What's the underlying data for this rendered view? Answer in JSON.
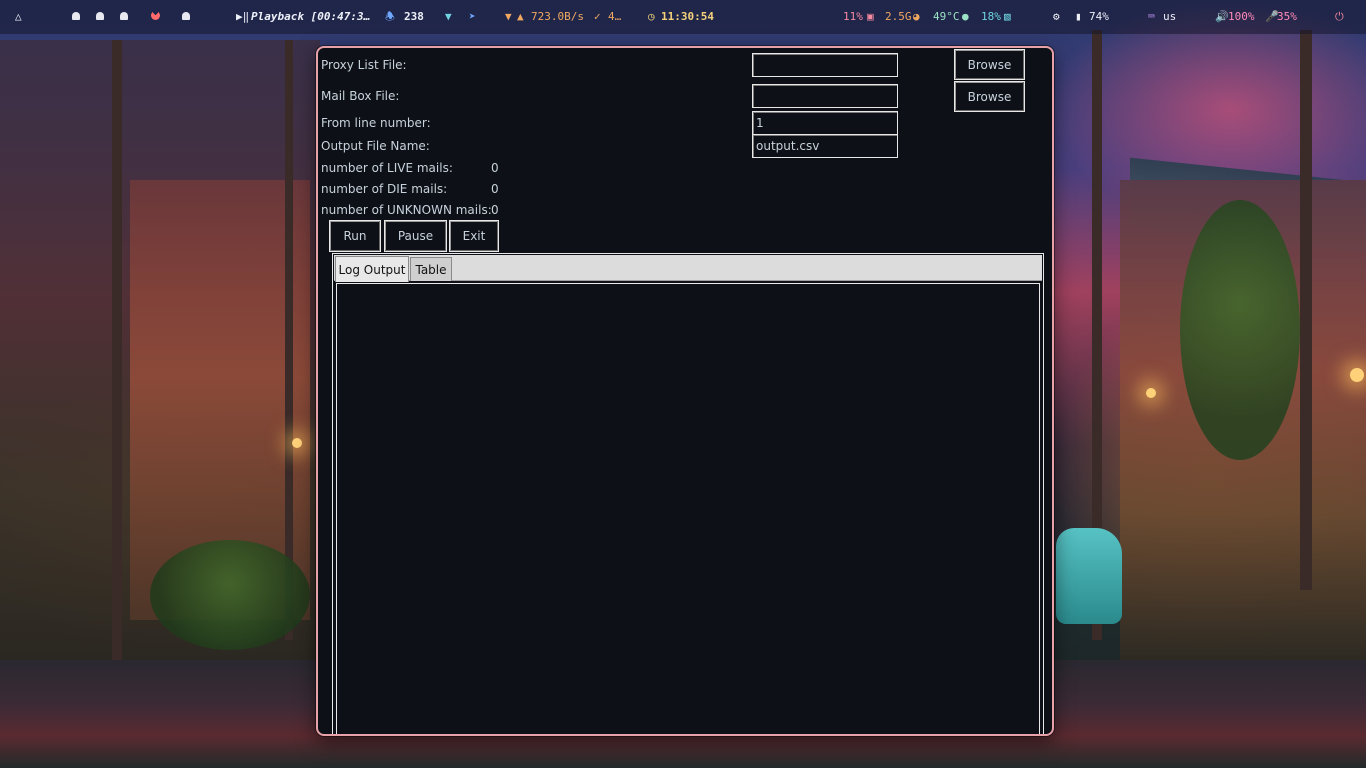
{
  "topbar": {
    "playback": "Playback [00:47:3…",
    "notifications": "238",
    "net_speed": "723.0B/s",
    "net_extra": "4…",
    "clock": "11:30:54",
    "cpu": "11%",
    "mem": "2.5G",
    "temp": "49°C",
    "disk": "18%",
    "battery": "74%",
    "keyboard": "us",
    "volume": "100%",
    "mic": "35%"
  },
  "form": {
    "proxy_label": "Proxy List File:",
    "proxy_value": "",
    "mailbox_label": "Mail Box File:",
    "mailbox_value": "",
    "browse_label": "Browse",
    "from_line_label": "From line number:",
    "from_line_value": "1",
    "output_label": "Output File Name:",
    "output_value": "output.csv",
    "live_label": "number of LIVE mails:",
    "live_count": "0",
    "die_label": "number of DIE mails:",
    "die_count": "0",
    "unknown_label": "number of UNKNOWN mails:",
    "unknown_count": "0"
  },
  "actions": {
    "run": "Run",
    "pause": "Pause",
    "exit": "Exit"
  },
  "tabs": [
    {
      "label": "Log Output"
    },
    {
      "label": "Table"
    }
  ],
  "colors": {
    "window_bg": "#0d1117",
    "window_border": "#e6a2a8",
    "text": "#c8d2dc",
    "tabbar_bg": "#dcdcdc"
  }
}
